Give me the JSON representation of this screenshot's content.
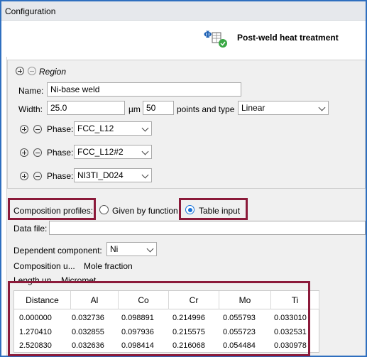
{
  "window": {
    "title": "Configuration"
  },
  "header": {
    "node_title": "Post-weld heat treatment"
  },
  "region": {
    "section_label": "Region",
    "name_label": "Name:",
    "name_value": "Ni-base weld",
    "width_label": "Width:",
    "width_value": "25.0",
    "width_unit": "µm",
    "points_value": "50",
    "points_type_label": "points and type",
    "points_type_value": "Linear",
    "phase_label": "Phase:",
    "phases": [
      "FCC_L12",
      "FCC_L12#2",
      "NI3TI_D024"
    ]
  },
  "composition": {
    "profiles_label": "Composition profiles:",
    "option_function": "Given by function",
    "option_table": "Table input",
    "selected": "Table input",
    "data_file_label": "Data file:",
    "data_file_value": "",
    "dependent_label": "Dependent component:",
    "dependent_value": "Ni",
    "comp_unit_label": "Composition u...",
    "comp_unit_value": "Mole fraction",
    "length_unit_label": "Length un...",
    "length_unit_value": "Micromet..."
  },
  "table": {
    "headers": [
      "Distance",
      "Al",
      "Co",
      "Cr",
      "Mo",
      "Ti"
    ],
    "rows": [
      [
        "0.000000",
        "0.032736",
        "0.098891",
        "0.214996",
        "0.055793",
        "0.033010"
      ],
      [
        "1.270410",
        "0.032855",
        "0.097936",
        "0.215575",
        "0.055723",
        "0.032531"
      ],
      [
        "2.520830",
        "0.032636",
        "0.098414",
        "0.216068",
        "0.054484",
        "0.030978"
      ]
    ]
  },
  "colors": {
    "highlight": "#8b1a3a",
    "accent": "#1a73d9",
    "frame": "#2f6fbf"
  }
}
